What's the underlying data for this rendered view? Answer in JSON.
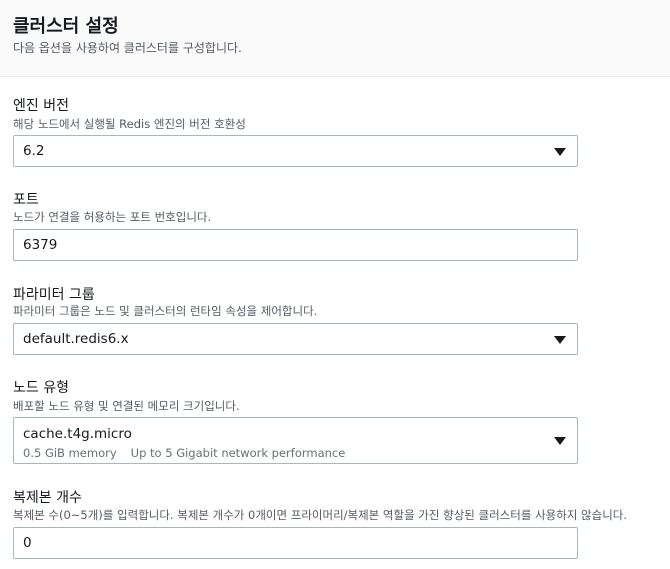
{
  "header": {
    "title": "클러스터 설정",
    "description": "다음 옵션을 사용하여 클러스터를 구성합니다."
  },
  "engine_version": {
    "label": "엔진 버전",
    "description": "해당 노드에서 실행될 Redis 엔진의 버전 호환성",
    "value": "6.2"
  },
  "port": {
    "label": "포트",
    "description": "노드가 연결을 허용하는 포트 번호입니다.",
    "value": "6379"
  },
  "parameter_group": {
    "label": "파라미터 그룹",
    "description": "파라미터 그룹은 노드 및 클러스터의 런타임 속성을 제어합니다.",
    "value": "default.redis6.x"
  },
  "node_type": {
    "label": "노드 유형",
    "description": "배포할 노드 유형 및 연결된 메모리 크기입니다.",
    "value": "cache.t4g.micro",
    "memory": "0.5 GiB memory",
    "network": "Up to 5 Gigabit network performance"
  },
  "replicas": {
    "label": "복제본 개수",
    "description": "복제본 수(0~5개)를 입력합니다. 복제본 개수가 0개이면 프라이머리/복제본 역할을 가진 향상된 클러스터를 사용하지 않습니다.",
    "value": "0"
  },
  "icons": {
    "dropdown": "caret-down-icon"
  }
}
